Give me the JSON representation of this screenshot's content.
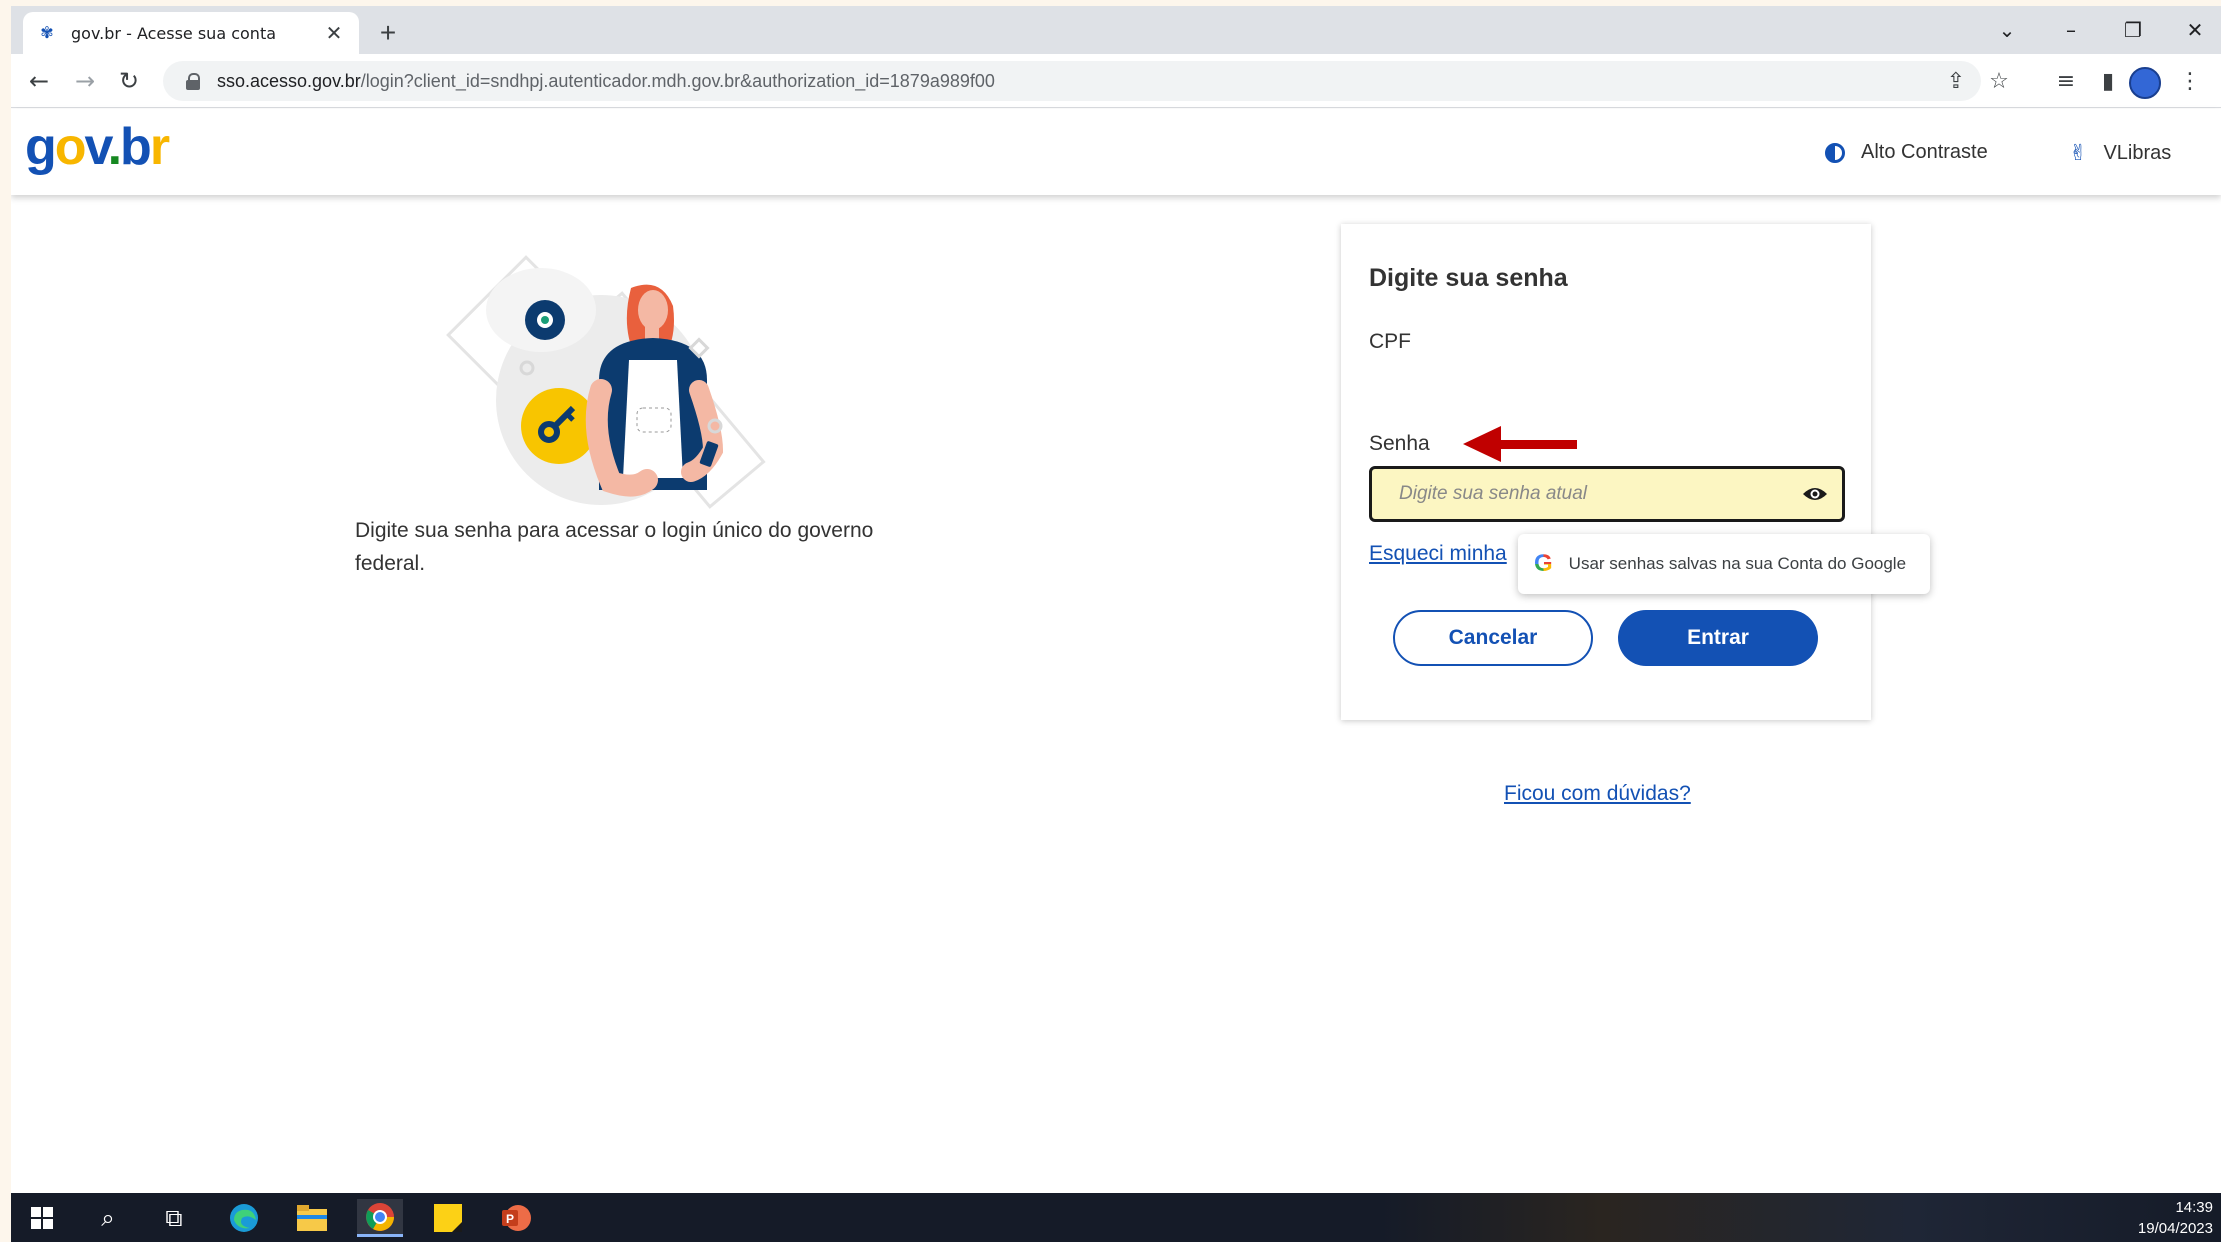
{
  "browser": {
    "tab_title": "gov.br - Acesse sua conta",
    "tab_close": "✕",
    "new_tab": "+",
    "url_host": "sso.acesso.gov.br",
    "url_path": "/login?client_id=sndhpj.autenticador.mdh.gov.br&authorization_id=1879a989f00",
    "window_controls": [
      "⌄",
      "–",
      "❐",
      "✕"
    ],
    "nav": {
      "back": "←",
      "forward": "→",
      "reload": "↻"
    },
    "toolbar_icons": {
      "share": "⇪",
      "bookmark": "☆",
      "media": "≡",
      "sidepanel": "▮",
      "menu": "⋮"
    }
  },
  "header": {
    "logo": {
      "g": "g",
      "o": "o",
      "v": "v",
      "dot": ".",
      "b": "b",
      "r": "r"
    },
    "high_contrast": "Alto Contraste",
    "vlibras": "VLibras"
  },
  "intro": {
    "text": "Digite sua senha para acessar o login único do governo federal."
  },
  "login": {
    "title": "Digite sua senha",
    "cpf_label": "CPF",
    "password_label": "Senha",
    "password_placeholder": "Digite sua senha atual",
    "forgot_link": "Esqueci minha",
    "cancel_button": "Cancelar",
    "enter_button": "Entrar"
  },
  "google_suggestion": {
    "text": "Usar senhas salvas na sua Conta do Google"
  },
  "help_link": "Ficou com dúvidas?",
  "taskbar": {
    "time": "14:39",
    "date": "19/04/2023"
  },
  "colors": {
    "primary": "#1351b4",
    "accent_yellow": "#f8b600",
    "arrow_red": "#c00000",
    "field_bg": "#fcf6c2"
  }
}
